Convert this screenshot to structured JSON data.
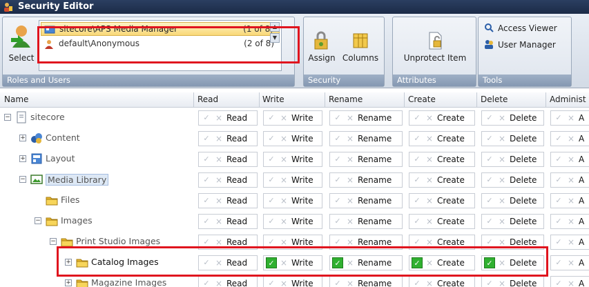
{
  "window": {
    "title": "Security Editor"
  },
  "ribbon": {
    "roles_group": {
      "label": "Roles and Users",
      "select_label": "Select",
      "users": [
        {
          "name": "sitecore\\APS Media Manager",
          "count": "(1 of 8)"
        },
        {
          "name": "default\\Anonymous",
          "count": "(2 of 8)"
        }
      ]
    },
    "security_group": {
      "label": "Security",
      "assign_label": "Assign",
      "columns_label": "Columns"
    },
    "attributes_group": {
      "label": "Attributes",
      "unprotect_label": "Unprotect Item"
    },
    "tools_group": {
      "label": "Tools",
      "access_viewer_label": "Access Viewer",
      "user_manager_label": "User Manager"
    }
  },
  "grid": {
    "columns": [
      "Name",
      "Read",
      "Write",
      "Rename",
      "Create",
      "Delete",
      "Administ"
    ],
    "rows": [
      {
        "name": "sitecore",
        "expander": "−",
        "icon": "page-icon"
      },
      {
        "name": "Content",
        "expander": "+",
        "icon": "content-icon"
      },
      {
        "name": "Layout",
        "expander": "+",
        "icon": "layout-icon"
      },
      {
        "name": "Media Library",
        "expander": "−",
        "icon": "media-icon"
      },
      {
        "name": "Files",
        "expander": "",
        "icon": "folder-icon"
      },
      {
        "name": "Images",
        "expander": "−",
        "icon": "folder-icon"
      },
      {
        "name": "Print Studio Images",
        "expander": "−",
        "icon": "folder-icon"
      },
      {
        "name": "Catalog Images",
        "expander": "+",
        "icon": "folder-icon"
      },
      {
        "name": "Magazine Images",
        "expander": "+",
        "icon": "folder-icon"
      }
    ],
    "perm_labels": {
      "read": "Read",
      "write": "Write",
      "rename": "Rename",
      "create": "Create",
      "delete": "Delete",
      "admin": "A"
    },
    "check_glyph": "✓",
    "cross_glyph": "×"
  },
  "colors": {
    "highlight": "#e0141e",
    "allow": "#30b030"
  }
}
